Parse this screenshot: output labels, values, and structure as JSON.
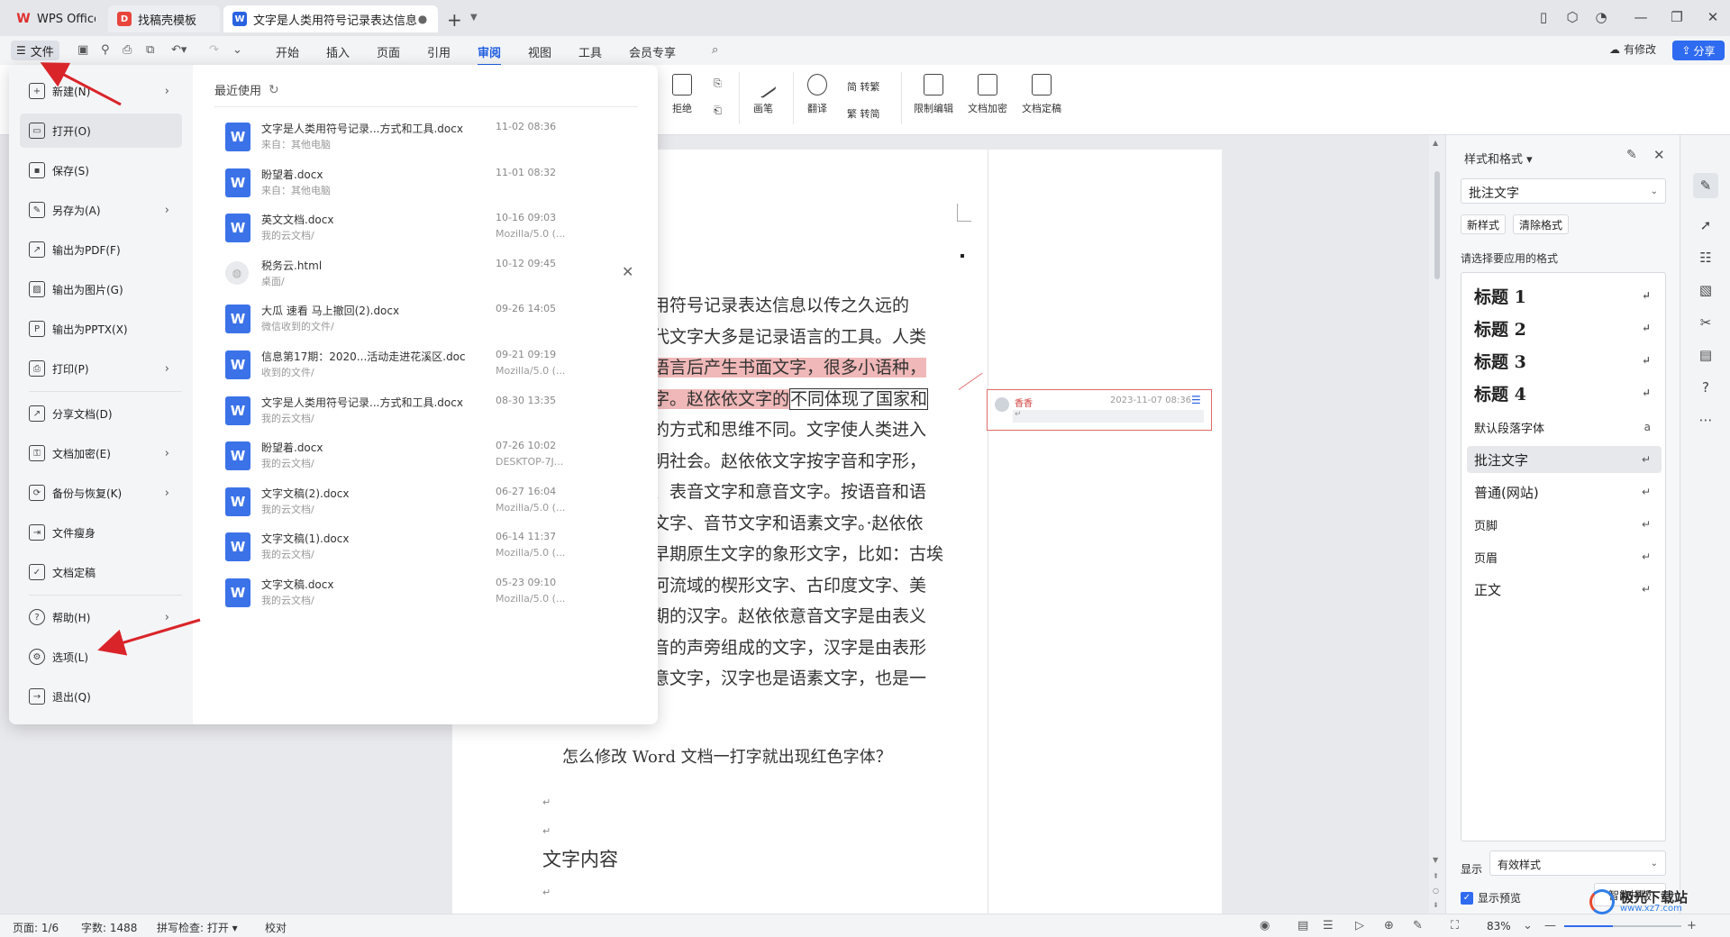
{
  "titlebar": {
    "tabs": [
      {
        "label": "WPS Office"
      },
      {
        "label": "找稿壳模板"
      },
      {
        "label": "文字是人类用符号记录表达信息以"
      }
    ]
  },
  "menubar": {
    "file_label": "文件",
    "tabs": [
      "开始",
      "插入",
      "页面",
      "引用",
      "审阅",
      "视图",
      "工具",
      "会员专享"
    ],
    "active_tab": "审阅",
    "modify_label": "有修改",
    "share_label": "分享"
  },
  "ribbon": {
    "reject": "拒绝",
    "brush": "画笔",
    "translate": "翻译",
    "to_traditional": "简 转繁",
    "to_simplified": "繁 转简",
    "restrict_edit": "限制编辑",
    "doc_encrypt": "文档加密",
    "doc_finalize": "文档定稿"
  },
  "file_menu": {
    "items": [
      {
        "label": "新建(N)",
        "icon": "new-file-icon",
        "has_arrow": true
      },
      {
        "label": "打开(O)",
        "icon": "folder-open-icon",
        "has_arrow": false
      },
      {
        "label": "保存(S)",
        "icon": "save-icon",
        "has_arrow": false
      },
      {
        "label": "另存为(A)",
        "icon": "save-as-icon",
        "has_arrow": true
      },
      {
        "label": "输出为PDF(F)",
        "icon": "pdf-icon",
        "has_arrow": false
      },
      {
        "label": "输出为图片(G)",
        "icon": "image-icon",
        "has_arrow": false
      },
      {
        "label": "输出为PPTX(X)",
        "icon": "pptx-icon",
        "has_arrow": false
      },
      {
        "label": "打印(P)",
        "icon": "print-icon",
        "has_arrow": true
      },
      {
        "label": "分享文档(D)",
        "icon": "share-icon",
        "has_arrow": false
      },
      {
        "label": "文档加密(E)",
        "icon": "lock-file-icon",
        "has_arrow": true
      },
      {
        "label": "备份与恢复(K)",
        "icon": "backup-icon",
        "has_arrow": true
      },
      {
        "label": "文件瘦身",
        "icon": "compress-icon",
        "has_arrow": false
      },
      {
        "label": "文档定稿",
        "icon": "finalize-icon",
        "has_arrow": false
      },
      {
        "label": "帮助(H)",
        "icon": "help-icon",
        "has_arrow": true
      },
      {
        "label": "选项(L)",
        "icon": "settings-icon",
        "has_arrow": false
      },
      {
        "label": "退出(Q)",
        "icon": "exit-icon",
        "has_arrow": false
      }
    ],
    "recent_title": "最近使用",
    "recent_files": [
      {
        "name": "文字是人类用符号记录...方式和工具.docx",
        "source": "来自：其他电脑",
        "date": "11-02 08:36",
        "device": "",
        "type": "docx"
      },
      {
        "name": "盼望着.docx",
        "source": "来自：其他电脑",
        "date": "11-01 08:32",
        "device": "",
        "type": "docx"
      },
      {
        "name": "英文文档.docx",
        "source": "我的云文档/",
        "date": "10-16 09:03",
        "device": "Mozilla/5.0 (...",
        "type": "docx"
      },
      {
        "name": "税务云.html",
        "source": "桌面/",
        "date": "10-12 09:45",
        "device": "",
        "type": "html"
      },
      {
        "name": "大瓜 速看 马上撤回(2).docx",
        "source": "微信收到的文件/",
        "date": "09-26 14:05",
        "device": "",
        "type": "docx"
      },
      {
        "name": "信息第17期：2020...活动走进花溪区.doc",
        "source": "收到的文件/",
        "date": "09-21 09:19",
        "device": "Mozilla/5.0 (...",
        "type": "docx"
      },
      {
        "name": "文字是人类用符号记录...方式和工具.docx",
        "source": "我的云文档/",
        "date": "08-30 13:35",
        "device": "",
        "type": "docx"
      },
      {
        "name": "盼望着.docx",
        "source": "我的云文档/",
        "date": "07-26 10:02",
        "device": "DESKTOP-7J...",
        "type": "docx"
      },
      {
        "name": "文字文稿(2).docx",
        "source": "我的云文档/",
        "date": "06-27 16:04",
        "device": "Mozilla/5.0 (...",
        "type": "docx"
      },
      {
        "name": "文字文稿(1).docx",
        "source": "我的云文档/",
        "date": "06-14 11:37",
        "device": "Mozilla/5.0 (...",
        "type": "docx"
      },
      {
        "name": "文字文稿.docx",
        "source": "我的云文档/",
        "date": "05-23 09:10",
        "device": "Mozilla/5.0 (...",
        "type": "docx"
      }
    ]
  },
  "document": {
    "lines": [
      "类用符号记录表达信息以传之久远的",
      "现代文字大多是记录语言的工具。人类",
      "的语言后产生书面文字，很多小语种，",
      "文字。赵依依文字的不同体现了国家和",
      "达的方式和思维不同。文字使人类进入",
      "文明社会。赵依依文字按字音和字形，",
      "字、表音文字和意音文字。按语音和语",
      "素文字、音节文字和语素文字。·赵依依",
      "类早期原生文字的象形文字，比如：古埃",
      "两河流域的楔形文字、古印度文字、美",
      "早期的汉字。赵依依意音文字是由表义",
      "表音的声旁组成的文字，汉字是由表形",
      "表意文字，汉字也是语素文字，也是一"
    ],
    "line3_highlight": "的语言后产生书面文字，很多小语种，",
    "line4_highlight": "文字。赵依依文字的",
    "line4_rest": "不同体现了国家和",
    "question": "怎么修改 Word 文档一打字就出现红色字体？",
    "heading": "文字内容"
  },
  "comment": {
    "author": "香香",
    "time": "2023-11-07 08:36"
  },
  "styles_panel": {
    "title": "样式和格式",
    "current_style": "批注文字",
    "new_style": "新样式",
    "clear_format": "清除格式",
    "hint": "请选择要应用的格式",
    "styles": [
      {
        "label": "标题  1",
        "kind": "big"
      },
      {
        "label": "标题  2",
        "kind": "big"
      },
      {
        "label": "标题  3",
        "kind": "big"
      },
      {
        "label": "标题  4",
        "kind": "big"
      },
      {
        "label": "默认段落字体",
        "kind": "small"
      },
      {
        "label": "批注文字",
        "kind": "norm"
      },
      {
        "label": "普通(网站)",
        "kind": "norm"
      },
      {
        "label": "页脚",
        "kind": "small"
      },
      {
        "label": "页眉",
        "kind": "small"
      },
      {
        "label": "正文",
        "kind": "norm"
      }
    ],
    "selected_style": "批注文字",
    "show_label": "显示",
    "show_value": "有效样式",
    "preview_label": "显示预览",
    "smart_layout": "智能排版"
  },
  "statusbar": {
    "page": "页面: 1/6",
    "words": "字数: 1488",
    "spell": "拼写检查: 打开",
    "proof": "校对",
    "zoom": "83%",
    "zoom_fraction": 0.83
  },
  "watermark": {
    "text": "极光下载站",
    "url": "www.xz7.com"
  },
  "colors": {
    "accent": "#2f6bf0",
    "highlight": "#f0b8b8",
    "annotation_arrow": "#d9252a"
  }
}
